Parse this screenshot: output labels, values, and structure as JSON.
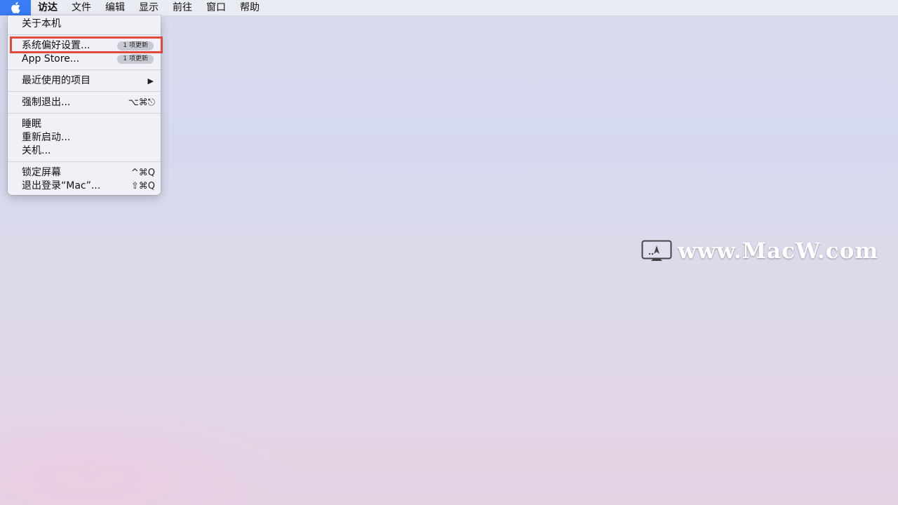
{
  "menubar": {
    "apple_icon": "apple-logo-icon",
    "items": [
      "访达",
      "文件",
      "编辑",
      "显示",
      "前往",
      "窗口",
      "帮助"
    ]
  },
  "apple_menu": {
    "about": "关于本机",
    "system_prefs": "系统偏好设置...",
    "system_prefs_badge": "1 项更新",
    "app_store": "App Store...",
    "app_store_badge": "1 项更新",
    "recent_items": "最近使用的项目",
    "force_quit": "强制退出...",
    "force_quit_shortcut": "⌥⌘⎋",
    "sleep": "睡眠",
    "restart": "重新启动...",
    "shutdown": "关机...",
    "lock_screen": "锁定屏幕",
    "lock_screen_shortcut": "^⌘Q",
    "logout": "退出登录“Mac”...",
    "logout_shortcut": "⇧⌘Q"
  },
  "highlight_color": "#e2493d",
  "accent_color": "#3a7cf5",
  "watermark": {
    "text": "www.MacW.com",
    "icon": "monitor-logo-icon"
  }
}
